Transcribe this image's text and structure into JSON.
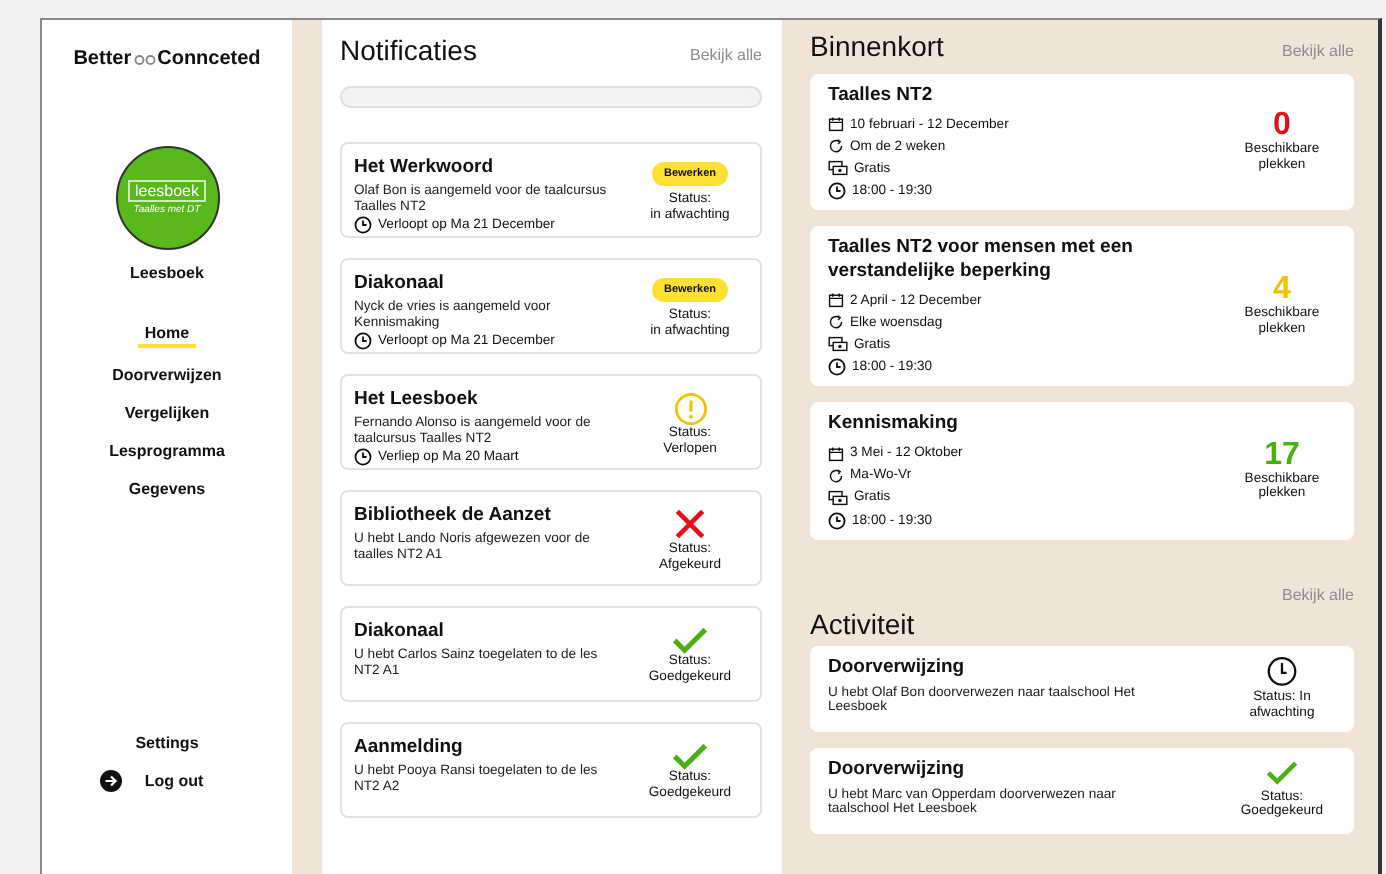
{
  "sidebar": {
    "logo": {
      "left": "Better",
      "right": "Connceted"
    },
    "avatar": {
      "title": "leesboek",
      "subtitle": "Taalles met DT"
    },
    "account_name": "Leesboek",
    "nav": [
      {
        "label": "Home",
        "selected": true
      },
      {
        "label": "Doorverwijzen",
        "selected": false
      },
      {
        "label": "Vergelijken",
        "selected": false
      },
      {
        "label": "Lesprogramma",
        "selected": false
      },
      {
        "label": "Gegevens",
        "selected": false
      }
    ],
    "settings": "Settings",
    "logout": "Log out"
  },
  "notifications": {
    "title": "Notificaties",
    "view_all": "Bekijk alle",
    "items": [
      {
        "kind": "pending",
        "title": "Het Werkwoord",
        "text": "Olaf Bon is aangemeld voor de taalcursus Taalles NT2",
        "due": "Verloopt op Ma 21 December",
        "button": "Bewerken",
        "status_label": "Status:",
        "status": "in afwachting"
      },
      {
        "kind": "pending",
        "title": "Diakonaal",
        "text": "Nyck de vries  is aangemeld voor Kennismaking",
        "due": "Verloopt op Ma 21 December",
        "button": "Bewerken",
        "status_label": "Status:",
        "status": "in afwachting"
      },
      {
        "kind": "expired",
        "title": "Het Leesboek",
        "text": "Fernando Alonso is aangemeld voor de taalcursus Taalles NT2",
        "due": "Verliep op Ma 20 Maart",
        "status_label": "Status:",
        "status": "Verlopen"
      },
      {
        "kind": "rejected",
        "title": "Bibliotheek de Aanzet",
        "text": "U hebt Lando Noris afgewezen voor de taalles NT2 A1",
        "status_label": "Status:",
        "status": "Afgekeurd"
      },
      {
        "kind": "approved",
        "title": "Diakonaal",
        "text": "U hebt Carlos Sainz toegelaten to de les NT2 A1",
        "status_label": "Status:",
        "status": "Goedgekeurd"
      },
      {
        "kind": "approved",
        "title": "Aanmelding",
        "text": "U hebt Pooya Ransi toegelaten to de les NT2 A2",
        "status_label": "Status:",
        "status": "Goedgekeurd"
      }
    ]
  },
  "upcoming": {
    "title": "Binnenkort",
    "view_all": "Bekijk alle",
    "items": [
      {
        "title": "Taalles NT2",
        "dates": "10 februari - 12 December",
        "frequency": "Om de 2 weken",
        "price": "Gratis",
        "time": "18:00 - 19:30",
        "count": "0",
        "color": "#e3101b",
        "count_label": "Beschikbare plekken"
      },
      {
        "title": "Taalles NT2 voor mensen met een verstandelijke beperking",
        "dates": "2 April - 12 December",
        "frequency": "Elke woensdag",
        "price": "Gratis",
        "time": "18:00 - 19:30",
        "count": "4",
        "color": "#f2c200",
        "count_label": "Beschikbare plekken"
      },
      {
        "title": "Kennismaking",
        "dates": "3 Mei - 12 Oktober",
        "frequency": "Ma-Wo-Vr",
        "price": "Gratis",
        "time": "18:00 - 19:30",
        "count": "17",
        "color": "#4caf14",
        "count_label": "Beschikbare plekken"
      }
    ]
  },
  "activity": {
    "title": "Activiteit",
    "view_all": "Bekijk alle",
    "items": [
      {
        "kind": "pending",
        "title": "Doorverwijzing",
        "text": "U hebt Olaf Bon doorverwezen naar taalschool Het Leesboek",
        "status": "Status: In afwachting"
      },
      {
        "kind": "approved",
        "title": "Doorverwijzing",
        "text": "U hebt Marc van Opperdam doorverwezen naar taalschool Het Leesboek",
        "status": "Status: Goedgekeurd"
      }
    ]
  }
}
